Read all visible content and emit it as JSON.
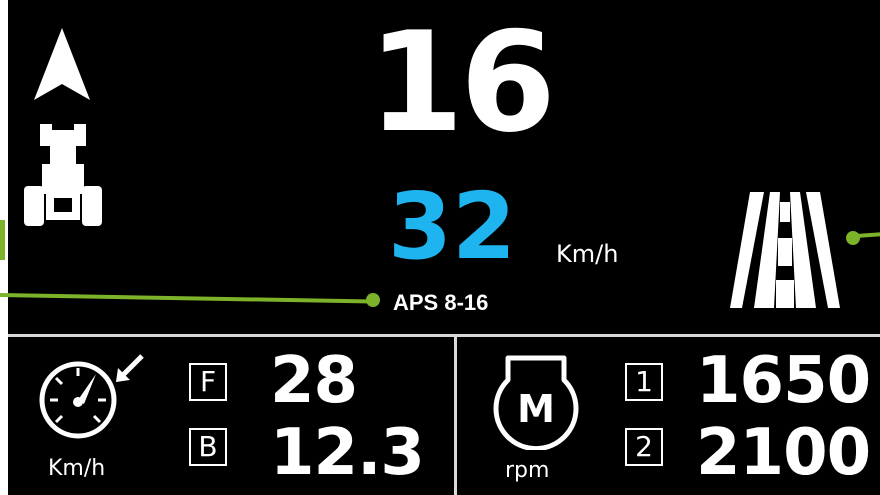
{
  "main": {
    "gear": "16",
    "speed": "32",
    "speed_unit": "Km/h",
    "mode_label": "APS 8-16"
  },
  "bottom_left": {
    "unit": "Km/h",
    "rows": [
      {
        "label": "F",
        "value": "28"
      },
      {
        "label": "B",
        "value": "12.3"
      }
    ]
  },
  "bottom_right": {
    "engine_label": "M",
    "unit": "rpm",
    "rows": [
      {
        "label": "1",
        "value": "1650"
      },
      {
        "label": "2",
        "value": "2100"
      }
    ]
  },
  "icons": {
    "direction": "north-arrow-icon",
    "vehicle": "tractor-icon",
    "road": "road-icon",
    "speedometer": "speedometer-icon",
    "engine": "engine-icon"
  },
  "colors": {
    "background": "#000000",
    "speed_blue": "#1eb4ef",
    "callout_green": "#7cb32b"
  }
}
